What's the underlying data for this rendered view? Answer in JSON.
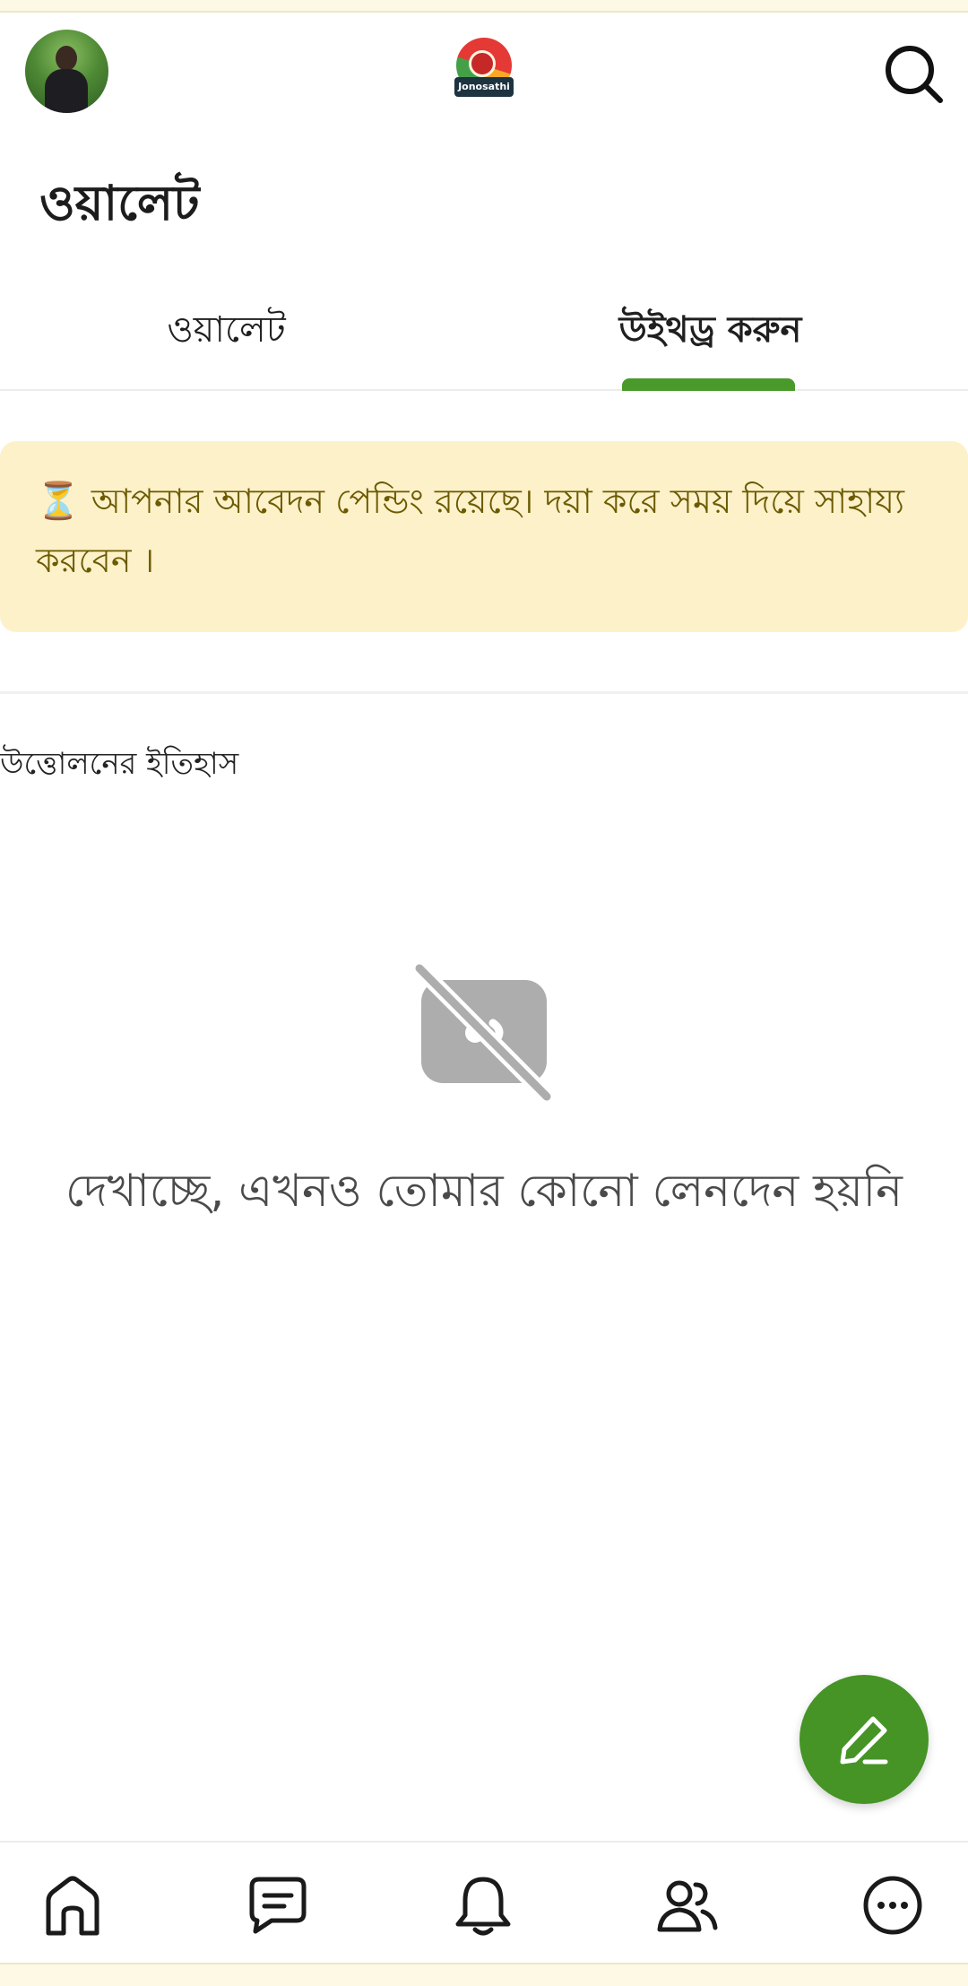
{
  "header": {
    "logo_text": "Jonosathi"
  },
  "page": {
    "title": "ওয়ালেট"
  },
  "tabs": [
    {
      "label": "ওয়ালেট",
      "active": false
    },
    {
      "label": "উইথড্র করুন",
      "active": true
    }
  ],
  "notice": {
    "icon": "hourglass-icon",
    "text": "আপনার আবেদন পেন্ডিং রয়েছে। দয়া করে সময় দিয়ে সাহায্য করবেন ।"
  },
  "history": {
    "label": "উত্তোলনের ইতিহাস",
    "empty_message": "দেখাচ্ছে, এখনও তোমার কোনো লেনদেন হয়নি"
  },
  "bottom_nav": [
    {
      "icon": "home-icon"
    },
    {
      "icon": "chat-icon"
    },
    {
      "icon": "bell-icon"
    },
    {
      "icon": "people-icon"
    },
    {
      "icon": "more-icon"
    }
  ],
  "colors": {
    "accent": "#469326",
    "notice_bg": "#fdf1c9",
    "notice_text": "#6b5a00"
  }
}
